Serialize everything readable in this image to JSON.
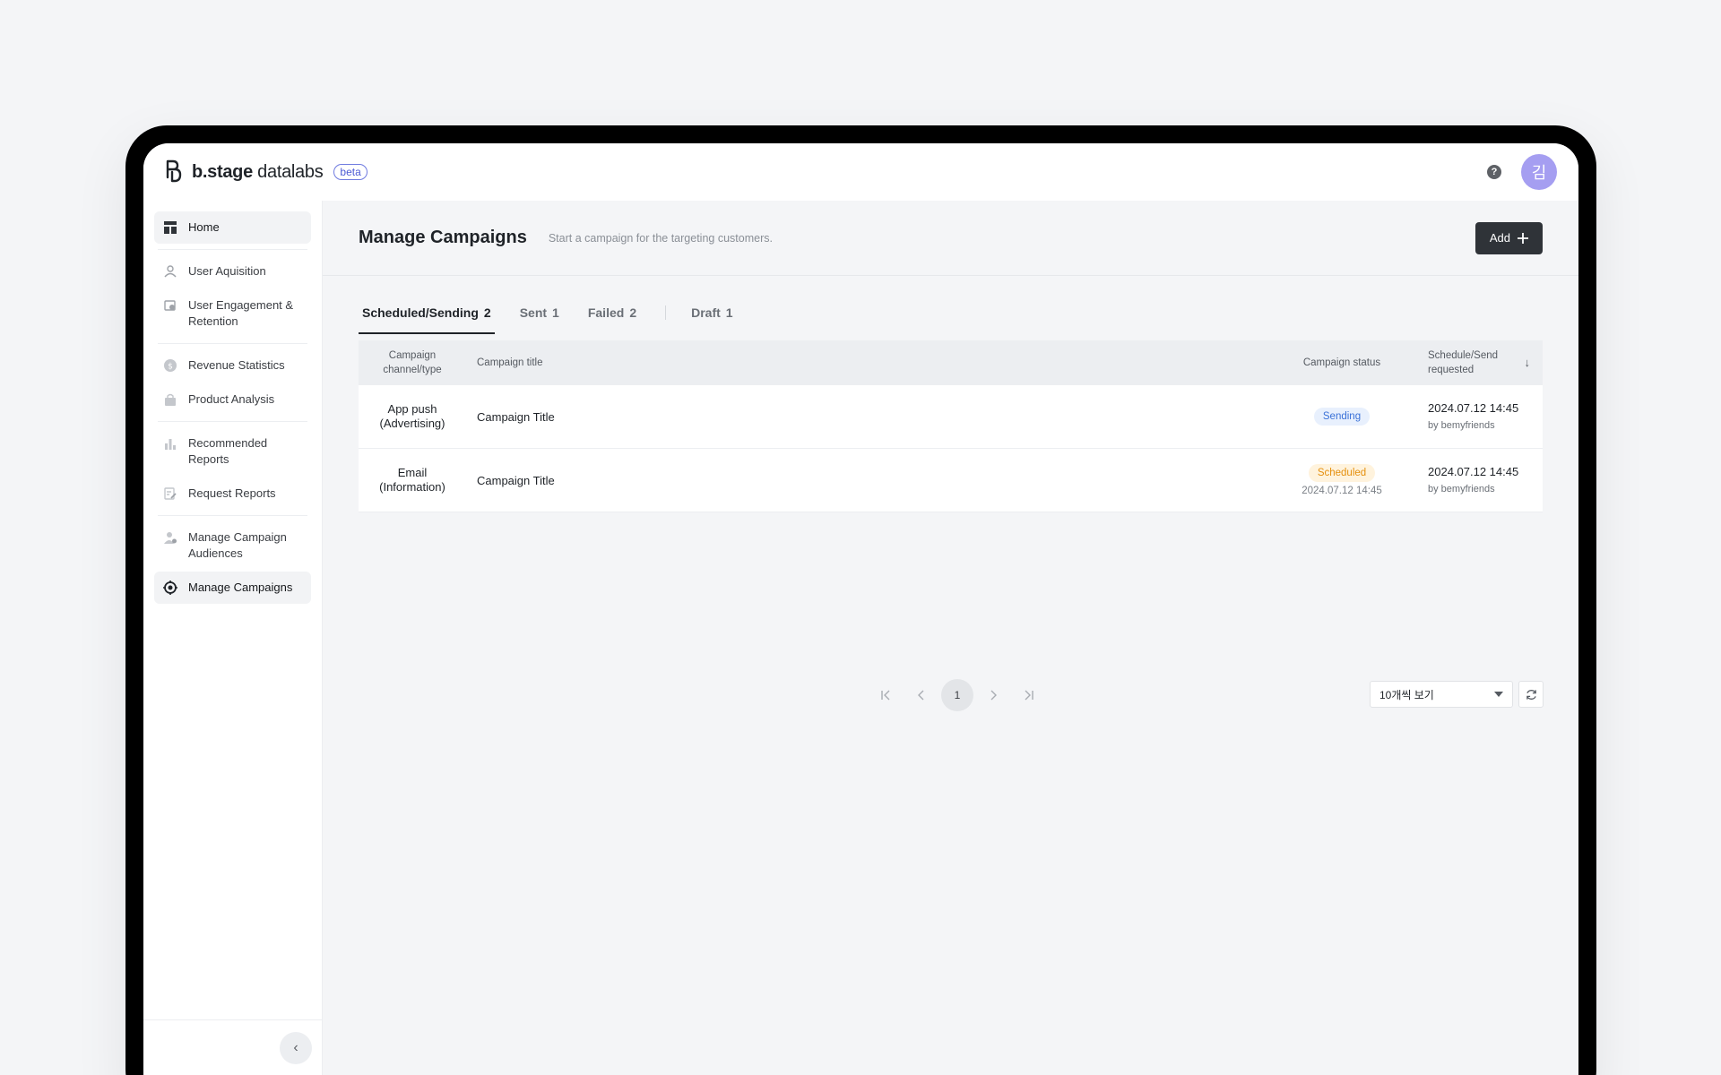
{
  "app": {
    "brand_bold": "b.stage",
    "brand_light": " datalabs",
    "beta_label": "beta",
    "avatar_initial": "김",
    "help_glyph": "?"
  },
  "sidebar": {
    "items": [
      {
        "label": "Home",
        "icon": "dashboard-icon"
      },
      {
        "label": "User Aquisition",
        "icon": "user-icon"
      },
      {
        "label": "User Engagement & Retention",
        "icon": "engagement-icon"
      },
      {
        "label": "Revenue Statistics",
        "icon": "dollar-icon"
      },
      {
        "label": "Product Analysis",
        "icon": "bag-icon"
      },
      {
        "label": "Recommended Reports",
        "icon": "bar-chart-icon"
      },
      {
        "label": "Request Reports",
        "icon": "edit-doc-icon"
      },
      {
        "label": "Manage Campaign Audiences",
        "icon": "audience-icon"
      },
      {
        "label": "Manage Campaigns",
        "icon": "target-icon"
      }
    ],
    "collapse_glyph": "‹"
  },
  "header": {
    "title": "Manage Campaigns",
    "subtitle": "Start a campaign for the targeting customers.",
    "add_label": "Add"
  },
  "tabs": [
    {
      "label": "Scheduled/Sending",
      "count": "2"
    },
    {
      "label": "Sent",
      "count": "1"
    },
    {
      "label": "Failed",
      "count": "2"
    },
    {
      "label": "Draft",
      "count": "1"
    }
  ],
  "table": {
    "columns": [
      "Campaign channel/type",
      "Campaign title",
      "Campaign status",
      "Schedule/Send requested"
    ],
    "rows": [
      {
        "channel": "App push",
        "type": "(Advertising)",
        "title": "Campaign Title",
        "status": "Sending",
        "status_date": "",
        "requested_at": "2024.07.12 14:45",
        "requested_by": "by bemyfriends"
      },
      {
        "channel": "Email",
        "type": "(Information)",
        "title": "Campaign Title",
        "status": "Scheduled",
        "status_date": "2024.07.12 14:45",
        "requested_at": "2024.07.12 14:45",
        "requested_by": "by bemyfriends"
      }
    ]
  },
  "pagination": {
    "current_page": "1",
    "page_size_label": "10개씩 보기"
  },
  "colors": {
    "sending": "#3a71d8",
    "scheduled": "#e5900e",
    "avatar": "#a59ef1",
    "primary_button": "#2f3338"
  }
}
